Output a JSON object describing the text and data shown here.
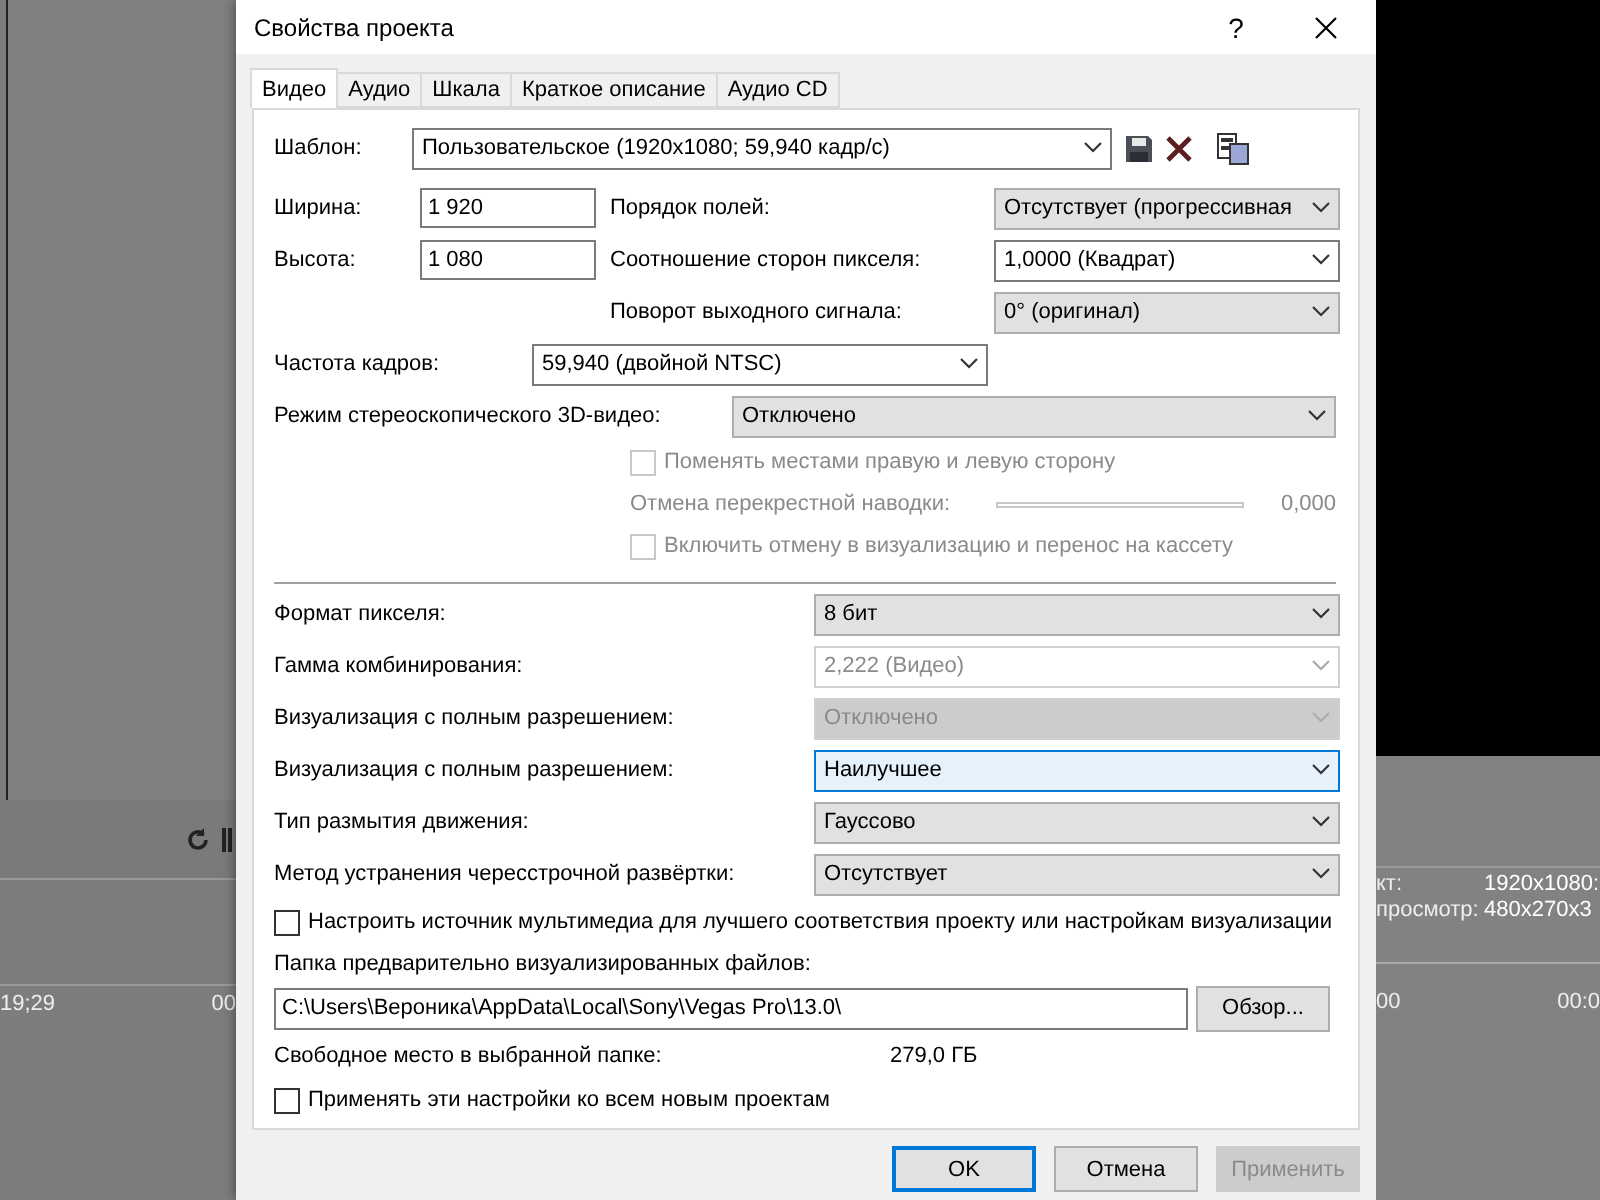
{
  "background": {
    "left_timecodes": [
      "19;29",
      "00"
    ],
    "right_info": [
      {
        "label": "кт:",
        "value": "1920x1080:"
      },
      {
        "label": "просмотр:",
        "value": "480x270x3"
      }
    ],
    "right_timecodes": [
      "00",
      "00:0"
    ]
  },
  "dialog": {
    "title": "Свойства проекта",
    "help": "?"
  },
  "tabs": [
    {
      "label": "Видео",
      "selected": true
    },
    {
      "label": "Аудио",
      "selected": false
    },
    {
      "label": "Шкала",
      "selected": false
    },
    {
      "label": "Краткое описание",
      "selected": false
    },
    {
      "label": "Аудио CD",
      "selected": false
    }
  ],
  "template": {
    "label": "Шаблон:",
    "value": "Пользовательское (1920x1080; 59,940 кадр/с)"
  },
  "top_rows": [
    {
      "label": "Ширина:",
      "value": "1 920",
      "right_label": "Порядок полей:",
      "right": {
        "value": "Отсутствует (прогрессивная",
        "kind": "list",
        "disabled": false,
        "focused": false
      }
    },
    {
      "label": "Высота:",
      "value": "1 080",
      "right_label": "Соотношение сторон пикселя:",
      "right": {
        "value": "1,0000 (Квадрат)",
        "kind": "edit",
        "disabled": false,
        "focused": false
      }
    },
    {
      "right_label": "Поворот выходного сигнала:",
      "right": {
        "value": "0° (оригинал)",
        "kind": "list",
        "disabled": false,
        "focused": false
      }
    }
  ],
  "frame_rate": {
    "label": "Частота кадров:",
    "value": "59,940 (двойной NTSC)",
    "kind": "edit",
    "disabled": false,
    "focused": false
  },
  "stereo": {
    "label": "Режим стереоскопического 3D-видео:",
    "value": "Отключено",
    "kind": "list",
    "disabled": false,
    "focused": false
  },
  "stereo_swap": {
    "label": "Поменять местами правую и левую сторону",
    "checked": false,
    "disabled": true
  },
  "crosstalk": {
    "label": "Отмена перекрестной наводки:",
    "level": 0,
    "reading": "0,000",
    "disabled": true
  },
  "stereo_render": {
    "label": "Включить отмену в визуализацию и перенос на кассету",
    "checked": false,
    "disabled": true
  },
  "settings": [
    {
      "label": "Формат пикселя:",
      "value": "8 бит",
      "kind": "list",
      "disabled": false,
      "focused": false
    },
    {
      "label": "Гамма комбинирования:",
      "value": "2,222 (Видео)",
      "kind": "edit",
      "disabled": true,
      "focused": false
    },
    {
      "label": "Визуализация с полным разрешением:",
      "value": "Отключено",
      "kind": "list",
      "disabled": true,
      "focused": false
    },
    {
      "label": "Визуализация с полным разрешением:",
      "value": "Наилучшее",
      "kind": "list",
      "disabled": false,
      "focused": true
    },
    {
      "label": "Тип размытия движения:",
      "value": "Гауссово",
      "kind": "list",
      "disabled": false,
      "focused": false
    },
    {
      "label": "Метод устранения чересстрочной развёртки:",
      "value": "Отсутствует",
      "kind": "list",
      "disabled": false,
      "focused": false
    }
  ],
  "adapt_media": {
    "label": "Настроить источник мультимедиа для лучшего соответствия проекту или настройкам визуализации",
    "checked": false,
    "disabled": false
  },
  "folder": {
    "label": "Папка предварительно визуализированных файлов:",
    "value": "C:\\Users\\Вероника\\AppData\\Local\\Sony\\Vegas Pro\\13.0\\",
    "browse": "Обзор..."
  },
  "free_space": {
    "label": "Свободное место в выбранной папке:",
    "value": "279,0 ГБ"
  },
  "apply_all": {
    "label": "Применять эти настройки ко всем новым проектам",
    "checked": false,
    "disabled": false
  },
  "buttons": [
    {
      "label": "OK",
      "kind": "default",
      "disabled": false
    },
    {
      "label": "Отмена",
      "kind": "normal",
      "disabled": false
    },
    {
      "label": "Применить",
      "kind": "normal",
      "disabled": true
    }
  ]
}
